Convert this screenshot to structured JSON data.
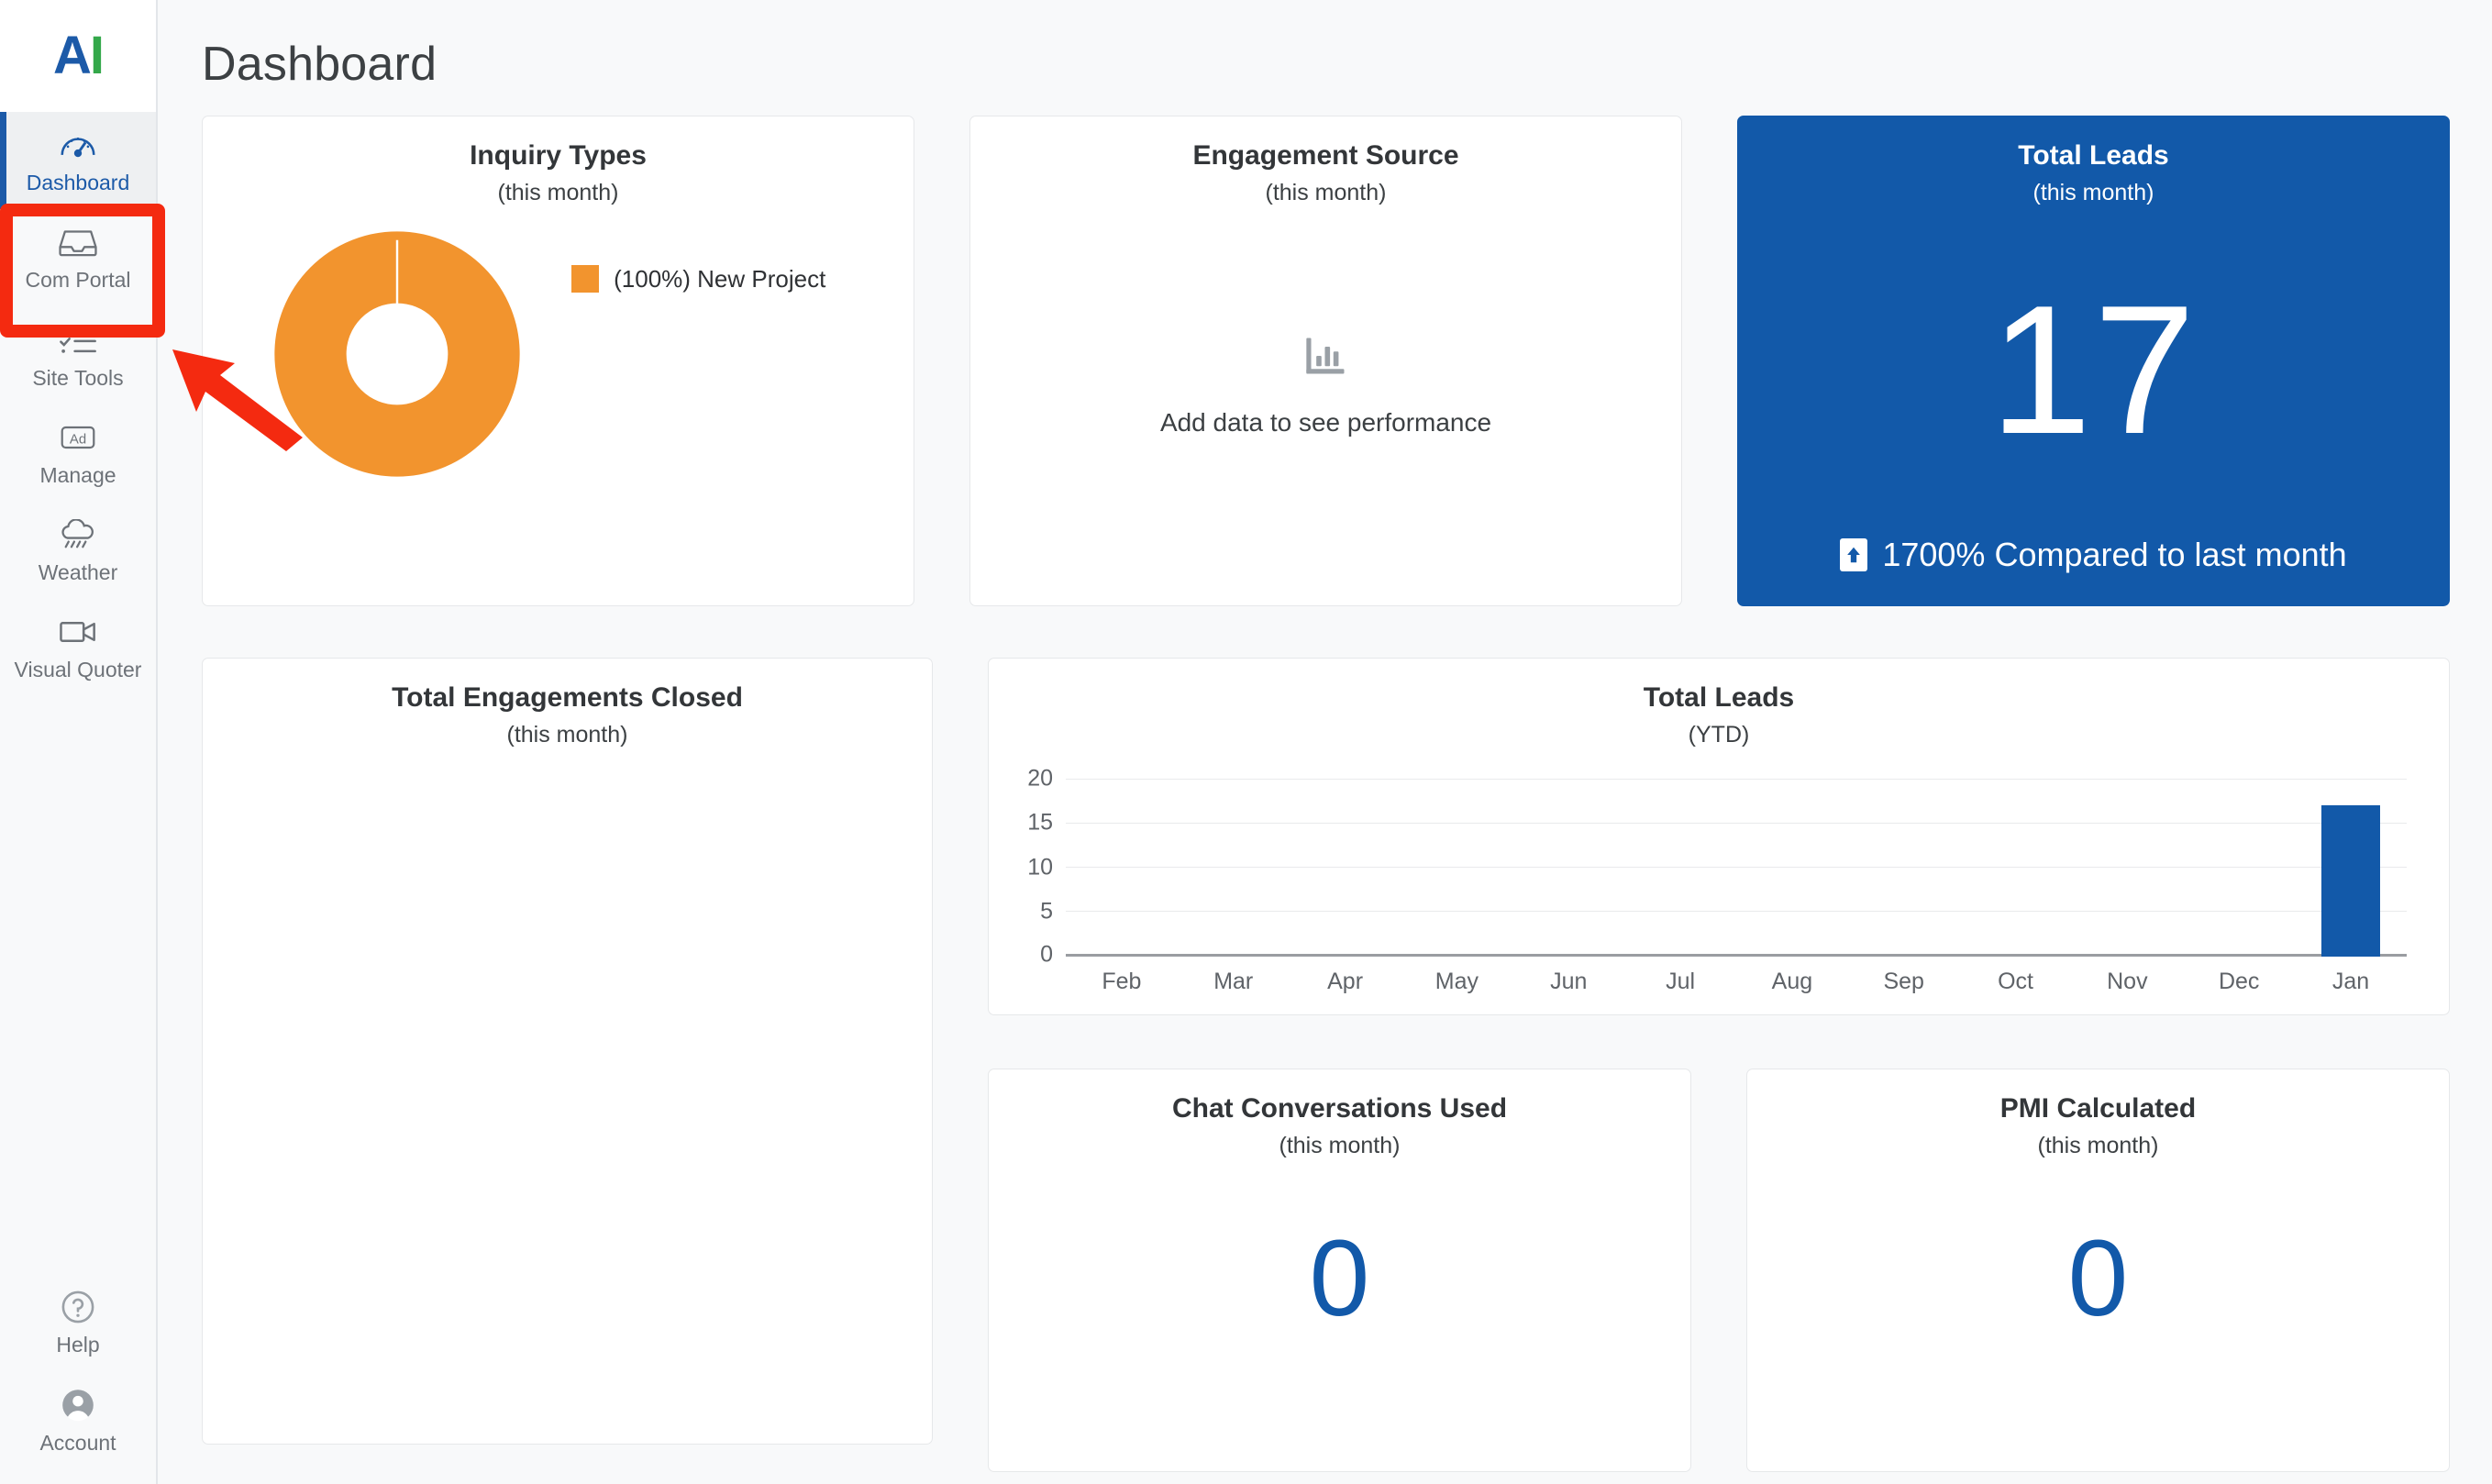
{
  "brand": {
    "logo_text_a": "A",
    "logo_text_i": "I",
    "accent_blue": "#1259a9",
    "accent_orange": "#f2942e",
    "annotation_red": "#f42a10"
  },
  "page": {
    "title": "Dashboard"
  },
  "sidebar": {
    "items": [
      {
        "label": "Dashboard",
        "icon": "gauge-icon",
        "active": true
      },
      {
        "label": "Com Portal",
        "icon": "inbox-icon",
        "active": false
      },
      {
        "label": "Site Tools",
        "icon": "checklist-icon",
        "active": false
      },
      {
        "label": "Manage",
        "icon": "ad-icon",
        "active": false
      },
      {
        "label": "Weather",
        "icon": "rain-cloud-icon",
        "active": false
      },
      {
        "label": "Visual Quoter",
        "icon": "video-camera-icon",
        "active": false
      }
    ],
    "bottom_items": [
      {
        "label": "Help",
        "icon": "question-circle-icon"
      },
      {
        "label": "Account",
        "icon": "user-circle-icon"
      }
    ]
  },
  "cards": {
    "inquiry_types": {
      "title": "Inquiry Types",
      "subtitle": "(this month)",
      "legend": [
        {
          "label": "(100%) New Project",
          "color": "#f2942e",
          "percent": 100
        }
      ]
    },
    "engagement_source": {
      "title": "Engagement Source",
      "subtitle": "(this month)",
      "empty_text": "Add data to see performance",
      "empty_icon": "bar-chart-icon"
    },
    "total_leads_kpi": {
      "title": "Total Leads",
      "subtitle": "(this month)",
      "value": "17",
      "delta_text": "1700% Compared to last month",
      "delta_icon": "arrow-up-icon"
    },
    "total_engagements_closed": {
      "title": "Total Engagements Closed",
      "subtitle": "(this month)"
    },
    "chat_conversations_used": {
      "title": "Chat Conversations Used",
      "subtitle": "(this month)",
      "value": "0"
    },
    "pmi_calculated": {
      "title": "PMI Calculated",
      "subtitle": "(this month)",
      "value": "0"
    }
  },
  "chart_data": [
    {
      "id": "inquiry-types-donut",
      "type": "pie",
      "title": "Inquiry Types",
      "subtitle": "(this month)",
      "categories": [
        "New Project"
      ],
      "values": [
        100
      ],
      "colors": [
        "#f2942e"
      ],
      "legend_labels": [
        "(100%) New Project"
      ],
      "legend_position": "right",
      "donut": true
    },
    {
      "id": "total-leads-ytd-bar",
      "type": "bar",
      "title": "Total Leads",
      "subtitle": "(YTD)",
      "categories": [
        "Feb",
        "Mar",
        "Apr",
        "May",
        "Jun",
        "Jul",
        "Aug",
        "Sep",
        "Oct",
        "Nov",
        "Dec",
        "Jan"
      ],
      "values": [
        0,
        0,
        0,
        0,
        0,
        0,
        0,
        0,
        0,
        0,
        0,
        17
      ],
      "yticks": [
        0,
        5,
        10,
        15,
        20
      ],
      "ylim": [
        0,
        20
      ],
      "xlabel": "",
      "ylabel": "",
      "grid": true,
      "series_color": "#1259a9"
    }
  ]
}
